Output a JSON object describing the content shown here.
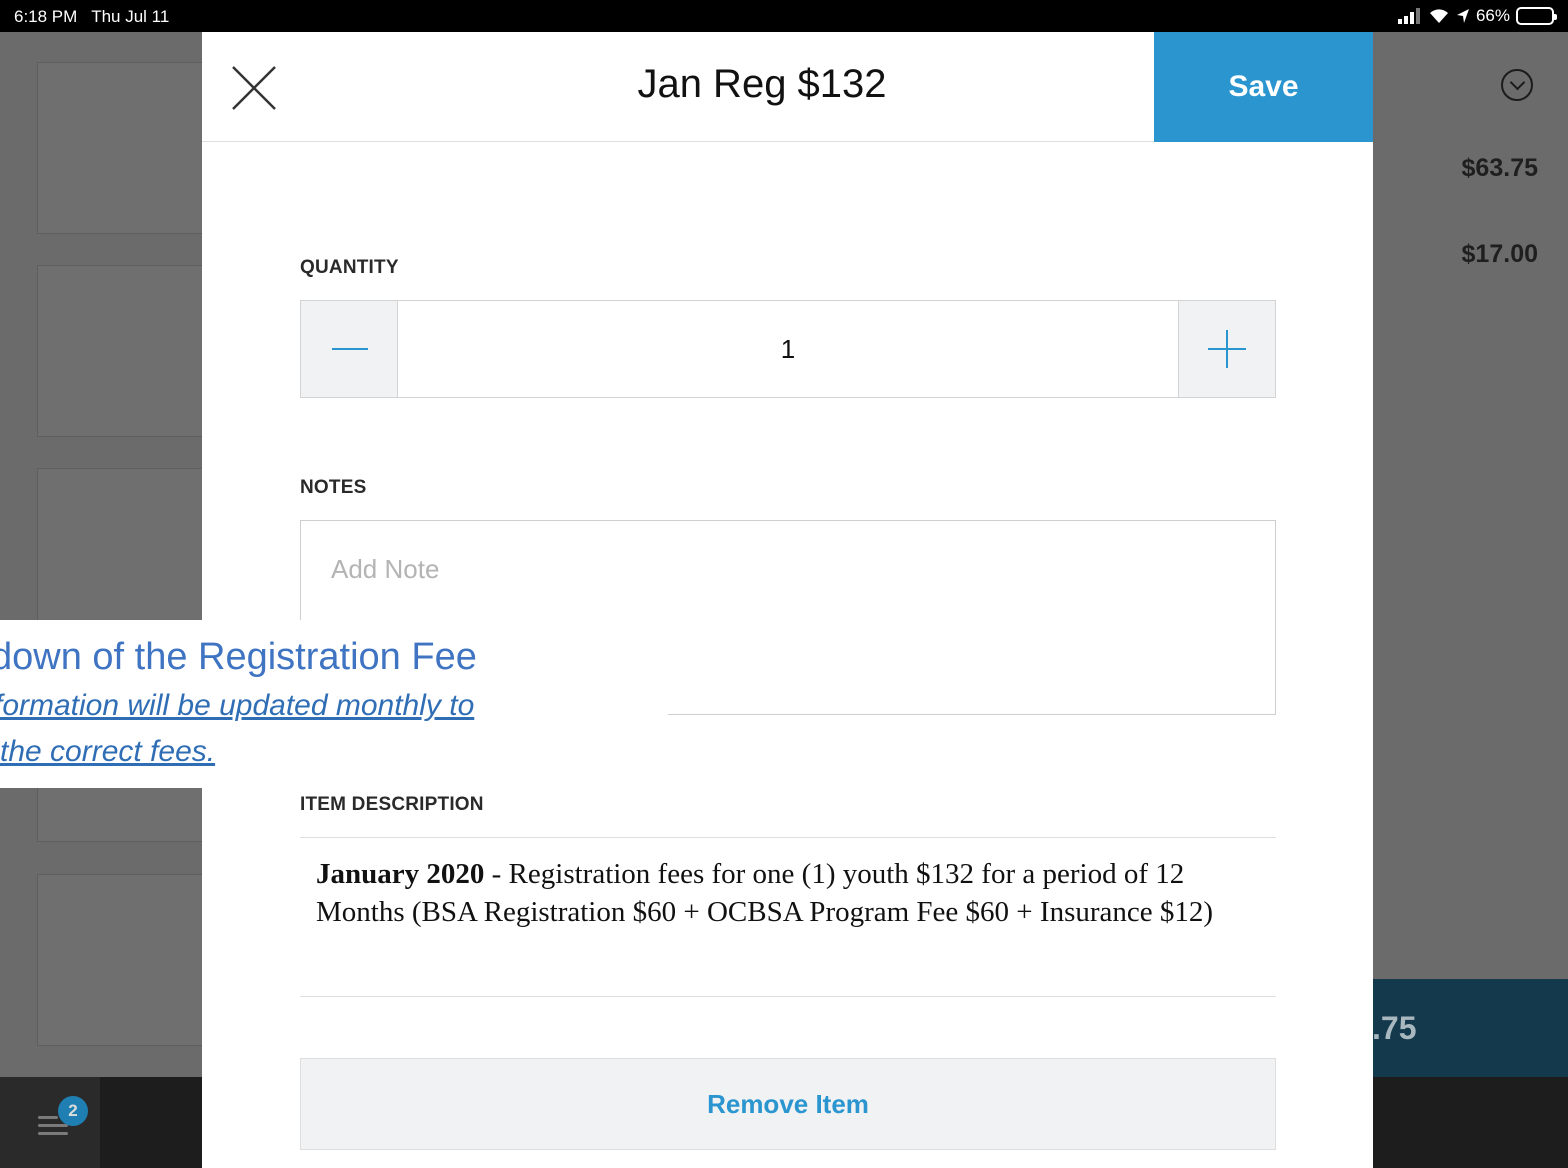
{
  "status_bar": {
    "time": "6:18 PM",
    "date": "Thu Jul 11",
    "battery": "66%",
    "battery_level": 0.66
  },
  "background": {
    "prices": [
      "$63.75",
      "$17.00"
    ],
    "total_partial": ".75",
    "cart_badge_count": "2"
  },
  "modal": {
    "title": "Jan Reg $132",
    "save_label": "Save",
    "quantity": {
      "label": "QUANTITY",
      "value": "1"
    },
    "notes": {
      "label": "NOTES",
      "placeholder": "Add Note"
    },
    "item_description": {
      "label": "ITEM DESCRIPTION",
      "bold_prefix": "January 2020",
      "text": " - Registration fees for one (1) youth $132 for a period of 12 Months (BSA Registration $60 + OCBSA Program Fee $60 + Insurance $12)"
    },
    "remove_label": "Remove Item"
  },
  "annotation": {
    "title": "kdown of the Registration Fee",
    "line1": "formation will be updated monthly to",
    "line2": "the correct fees."
  },
  "colors": {
    "accent": "#2a95cf",
    "annotation_blue": "#3f74c2"
  }
}
